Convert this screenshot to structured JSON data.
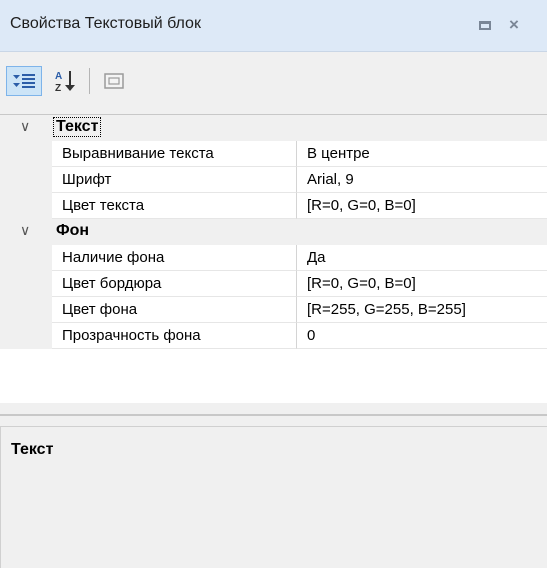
{
  "window": {
    "title": "Свойства Текстовый блок",
    "buttons": {
      "restore": "restore-icon",
      "close": "×"
    }
  },
  "toolbar": {
    "categorized_icon": "categorized-icon",
    "alphabetical_icon": "sort-az-icon",
    "property_pages_icon": "property-pages-icon"
  },
  "grid": {
    "categories": [
      {
        "label": "Текст",
        "expanded": true,
        "properties": [
          {
            "name": "Выравнивание текста",
            "value": "В центре"
          },
          {
            "name": "Шрифт",
            "value": "Arial, 9"
          },
          {
            "name": "Цвет текста",
            "value": "[R=0, G=0, B=0]"
          }
        ]
      },
      {
        "label": "Фон",
        "expanded": true,
        "properties": [
          {
            "name": "Наличие фона",
            "value": "Да"
          },
          {
            "name": "Цвет бордюра",
            "value": "[R=0, G=0, B=0]"
          },
          {
            "name": "Цвет фона",
            "value": "[R=255, G=255, B=255]"
          },
          {
            "name": "Прозрачность фона",
            "value": "0"
          }
        ]
      }
    ]
  },
  "description": {
    "title": "Текст"
  },
  "colors": {
    "titlebar": "#dde9f7",
    "selected_tool": "#cce4f7",
    "panel": "#f0f0f0"
  }
}
